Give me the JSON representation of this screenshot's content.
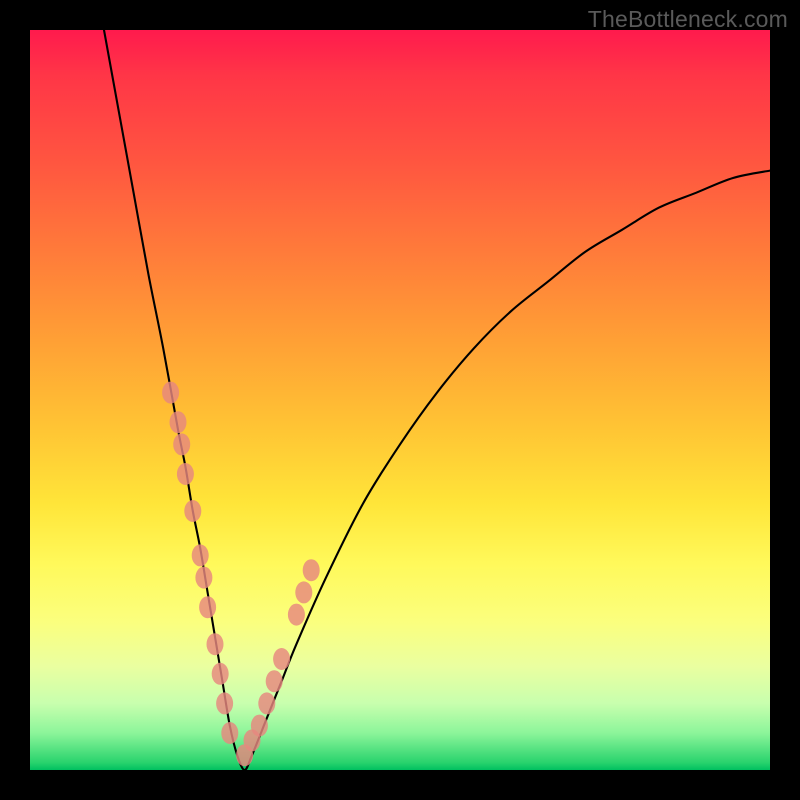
{
  "watermark": "TheBottleneck.com",
  "colors": {
    "frame": "#000000",
    "gradient_top": "#ff1a4d",
    "gradient_bottom": "#00c060",
    "curve": "#000000",
    "marker": "#e6877f"
  },
  "chart_data": {
    "type": "line",
    "title": "",
    "xlabel": "",
    "ylabel": "",
    "xlim": [
      0,
      100
    ],
    "ylim": [
      0,
      100
    ],
    "curve": {
      "x": [
        10,
        12,
        14,
        16,
        18,
        20,
        21,
        22,
        23,
        24,
        25,
        26,
        27,
        28,
        29,
        30,
        32,
        34,
        36,
        40,
        45,
        50,
        55,
        60,
        65,
        70,
        75,
        80,
        85,
        90,
        95,
        100
      ],
      "y": [
        100,
        89,
        78,
        67,
        57,
        46,
        41,
        35,
        30,
        24,
        18,
        12,
        6,
        2,
        0,
        2,
        7,
        12,
        17,
        26,
        36,
        44,
        51,
        57,
        62,
        66,
        70,
        73,
        76,
        78,
        80,
        81
      ]
    },
    "markers_left": [
      [
        19,
        51
      ],
      [
        20,
        47
      ],
      [
        20.5,
        44
      ],
      [
        21,
        40
      ],
      [
        22,
        35
      ],
      [
        23,
        29
      ],
      [
        23.5,
        26
      ],
      [
        24,
        22
      ],
      [
        25,
        17
      ],
      [
        25.7,
        13
      ],
      [
        26.3,
        9
      ],
      [
        27,
        5
      ]
    ],
    "markers_right": [
      [
        29,
        2
      ],
      [
        30,
        4
      ],
      [
        31,
        6
      ],
      [
        32,
        9
      ],
      [
        33,
        12
      ],
      [
        34,
        15
      ],
      [
        36,
        21
      ],
      [
        37,
        24
      ],
      [
        38,
        27
      ]
    ],
    "annotations": []
  }
}
